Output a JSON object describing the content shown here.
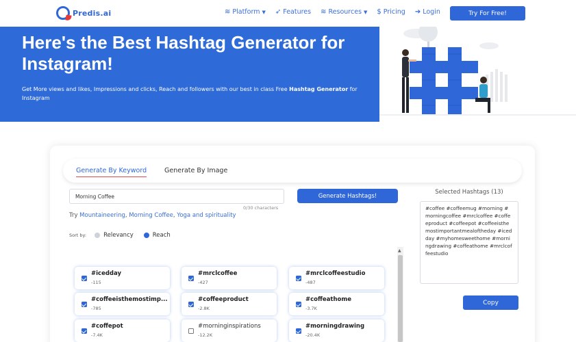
{
  "brand": {
    "name": "Predis.ai"
  },
  "nav": {
    "items": [
      {
        "label": "Platform",
        "icon": "layers-icon",
        "has_caret": true
      },
      {
        "label": "Features",
        "icon": "rocket-icon",
        "has_caret": false
      },
      {
        "label": "Resources",
        "icon": "layers-icon",
        "has_caret": true
      },
      {
        "label": "Pricing",
        "icon": "dollar-icon",
        "has_caret": false
      },
      {
        "label": "Login",
        "icon": "login-icon",
        "has_caret": false
      }
    ],
    "cta": "Try For Free!"
  },
  "hero": {
    "title": "Here's the Best Hashtag Generator for Instagram!",
    "subtitle_pre": "Get More views and likes, Impressions and clicks, Reach and followers with our best in class Free ",
    "subtitle_bold": "Hashtag Generator",
    "subtitle_post": " for Instagram"
  },
  "tabs": {
    "active": "Generate By Keyword",
    "other": "Generate By Image"
  },
  "form": {
    "keyword_value": "Morning Coffee",
    "char_count": "0/30 characters",
    "generate_label": "Generate Hashtags!",
    "try_prefix": "Try ",
    "suggestions": [
      "Mountaineering",
      "Morning Coffee",
      "Yoga and spirituality"
    ],
    "sort_label": "Sort by:",
    "sort_options": [
      "Relevancy",
      "Reach"
    ],
    "sort_selected": "Reach"
  },
  "selected": {
    "title": "Selected Hashtags (13)",
    "text": "#coffee #coffeemug #morning #morningcoffee #mrclcoffee #coffeeproduct #coffeepot #coffeeisthemostimportantmealoftheday #icedday #myhomesweethome #morningdrawing #coffeathome #mrclcoffeestudio",
    "copy_label": "Copy"
  },
  "hashtags": [
    {
      "name": "#icedday",
      "reach": "-115",
      "checked": true
    },
    {
      "name": "#mrclcoffee",
      "reach": "-427",
      "checked": true
    },
    {
      "name": "#mrclcoffeestudio",
      "reach": "-487",
      "checked": true
    },
    {
      "name": "#coffeeisthemostimp...",
      "reach": "-785",
      "checked": true
    },
    {
      "name": "#coffeeproduct",
      "reach": "-2.8K",
      "checked": true
    },
    {
      "name": "#coffeathome",
      "reach": "-3.7K",
      "checked": true
    },
    {
      "name": "#coffepot",
      "reach": "-7.4K",
      "checked": true
    },
    {
      "name": "#morninginspirations",
      "reach": "-12.2K",
      "checked": false
    },
    {
      "name": "#morningdrawing",
      "reach": "-20.4K",
      "checked": true
    }
  ],
  "colors": {
    "primary": "#2f67d8",
    "hero_bg": "#2f6ad9",
    "accent_red": "#e24b4b"
  }
}
